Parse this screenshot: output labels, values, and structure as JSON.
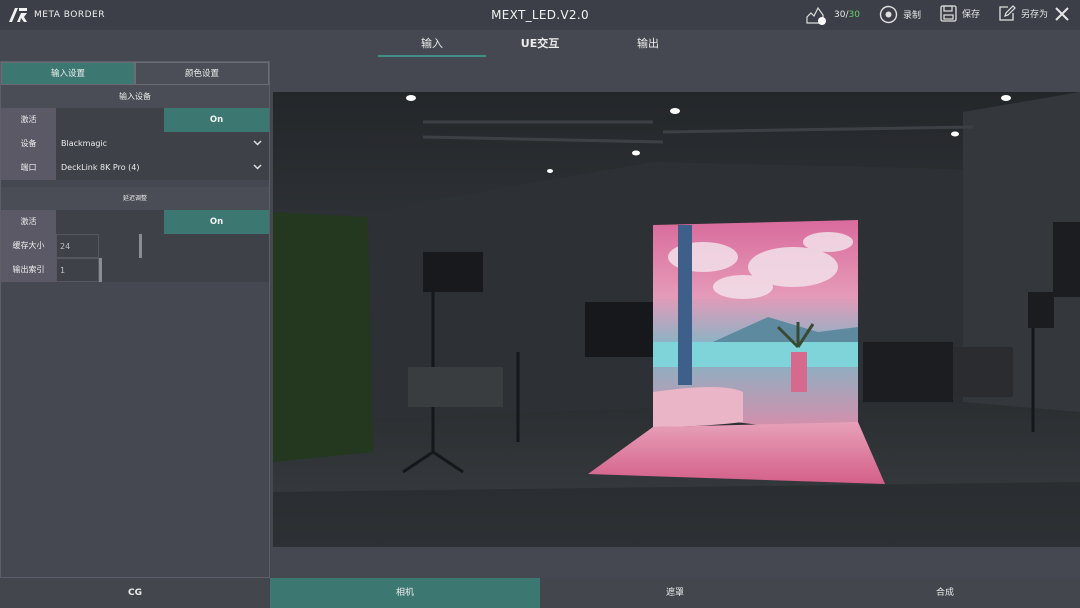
{
  "header": {
    "brand_mark": "DR",
    "brand_name": "META BORDER",
    "title": "MEXT_LED.V2.0",
    "fps_current": "30",
    "fps_separator": "/",
    "fps_max": "30",
    "record_label": "录制",
    "save_label": "保存",
    "save_as_label": "另存为"
  },
  "main_tabs": [
    {
      "label": "输入",
      "active": true
    },
    {
      "label": "UE交互",
      "active": false
    },
    {
      "label": "输出",
      "active": false
    }
  ],
  "panel": {
    "subtabs": [
      {
        "label": "输入设置",
        "active": true
      },
      {
        "label": "颜色设置",
        "active": false
      }
    ],
    "input_device": {
      "heading": "输入设备",
      "activate_label": "激活",
      "activate_state": "On",
      "device_label": "设备",
      "device_value": "Blackmagic",
      "port_label": "端口",
      "port_value": "DeckLink 8K Pro (4)"
    },
    "delay": {
      "heading": "延迟调整",
      "activate_label": "激活",
      "activate_state": "On",
      "buffer_label": "缓存大小",
      "buffer_value": "24",
      "output_index_label": "输出索引",
      "output_index_value": "1"
    }
  },
  "bottom_tabs": [
    {
      "label": "CG",
      "active": false
    },
    {
      "label": "相机",
      "active": true
    },
    {
      "label": "遮罩",
      "active": false
    },
    {
      "label": "合成",
      "active": false
    }
  ],
  "colors": {
    "accent": "#3c7771",
    "fps_max": "#5fd36a",
    "background": "#454850"
  }
}
